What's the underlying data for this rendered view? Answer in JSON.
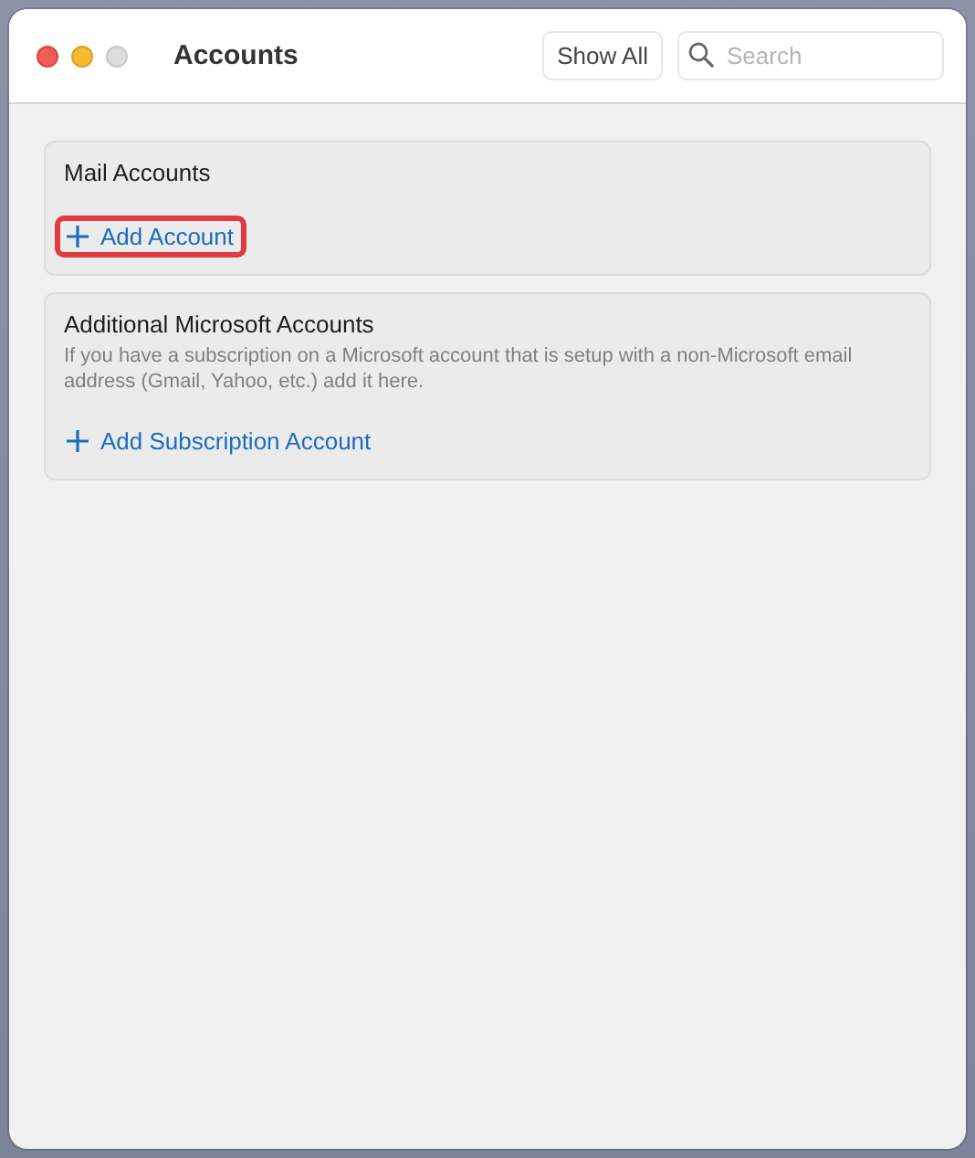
{
  "window": {
    "title": "Accounts"
  },
  "toolbar": {
    "show_all_button": "Show All",
    "search": {
      "placeholder": "Search"
    }
  },
  "sections": [
    {
      "title": "Mail Accounts",
      "actions": [
        {
          "label": "Add Account",
          "highlighted": true
        }
      ]
    },
    {
      "title": "Additional Microsoft Accounts",
      "description": "If you have a subscription on a Microsoft account that is setup with a non-Microsoft email address (Gmail, Yahoo, etc.) add it here.",
      "actions": [
        {
          "label": "Add Subscription Account",
          "highlighted": false
        }
      ]
    }
  ]
}
